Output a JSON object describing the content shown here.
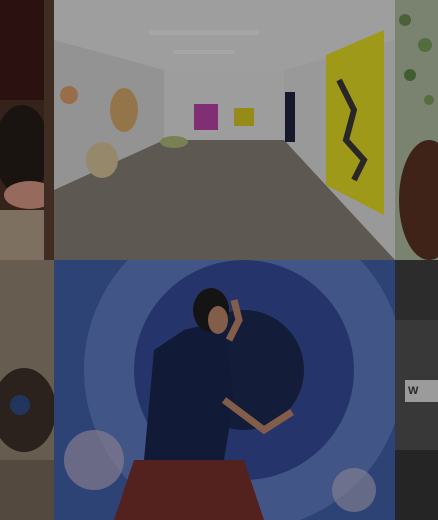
{
  "gallery": {
    "tiles": [
      {
        "name": "left-top-image",
        "caption": ""
      },
      {
        "name": "gallery-room-image",
        "caption": ""
      },
      {
        "name": "right-top-image",
        "caption": ""
      },
      {
        "name": "left-bottom-image",
        "caption": ""
      },
      {
        "name": "dancer-image",
        "caption": ""
      },
      {
        "name": "right-bottom-image",
        "caption": ""
      }
    ],
    "sign_text": "W"
  }
}
